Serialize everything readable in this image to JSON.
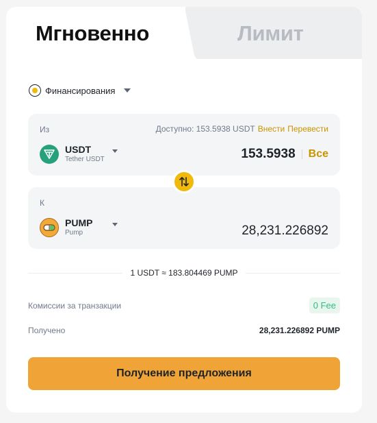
{
  "tabs": {
    "instant": "Мгновенно",
    "limit": "Лимит"
  },
  "funding": {
    "label": "Финансирования"
  },
  "from": {
    "label": "Из",
    "available_text": "Доступно: 153.5938 USDT",
    "deposit_link": "Внести",
    "transfer_link": "Перевести",
    "coin_symbol": "USDT",
    "coin_name": "Tether USDT",
    "amount": "153.5938",
    "max_label": "Все"
  },
  "to": {
    "label": "К",
    "coin_symbol": "PUMP",
    "coin_name": "Pump",
    "amount": "28,231.226892"
  },
  "rate": "1 USDT ≈ 183.804469 PUMP",
  "fee": {
    "label": "Комиссии за транзакции",
    "value": "0 Fee"
  },
  "received": {
    "label": "Получено",
    "value": "28,231.226892 PUMP"
  },
  "cta_label": "Получение предложения",
  "colors": {
    "accent": "#f0a437",
    "link": "#c99400",
    "fee_green": "#2ebd85",
    "usdt_green": "#26a17b"
  }
}
